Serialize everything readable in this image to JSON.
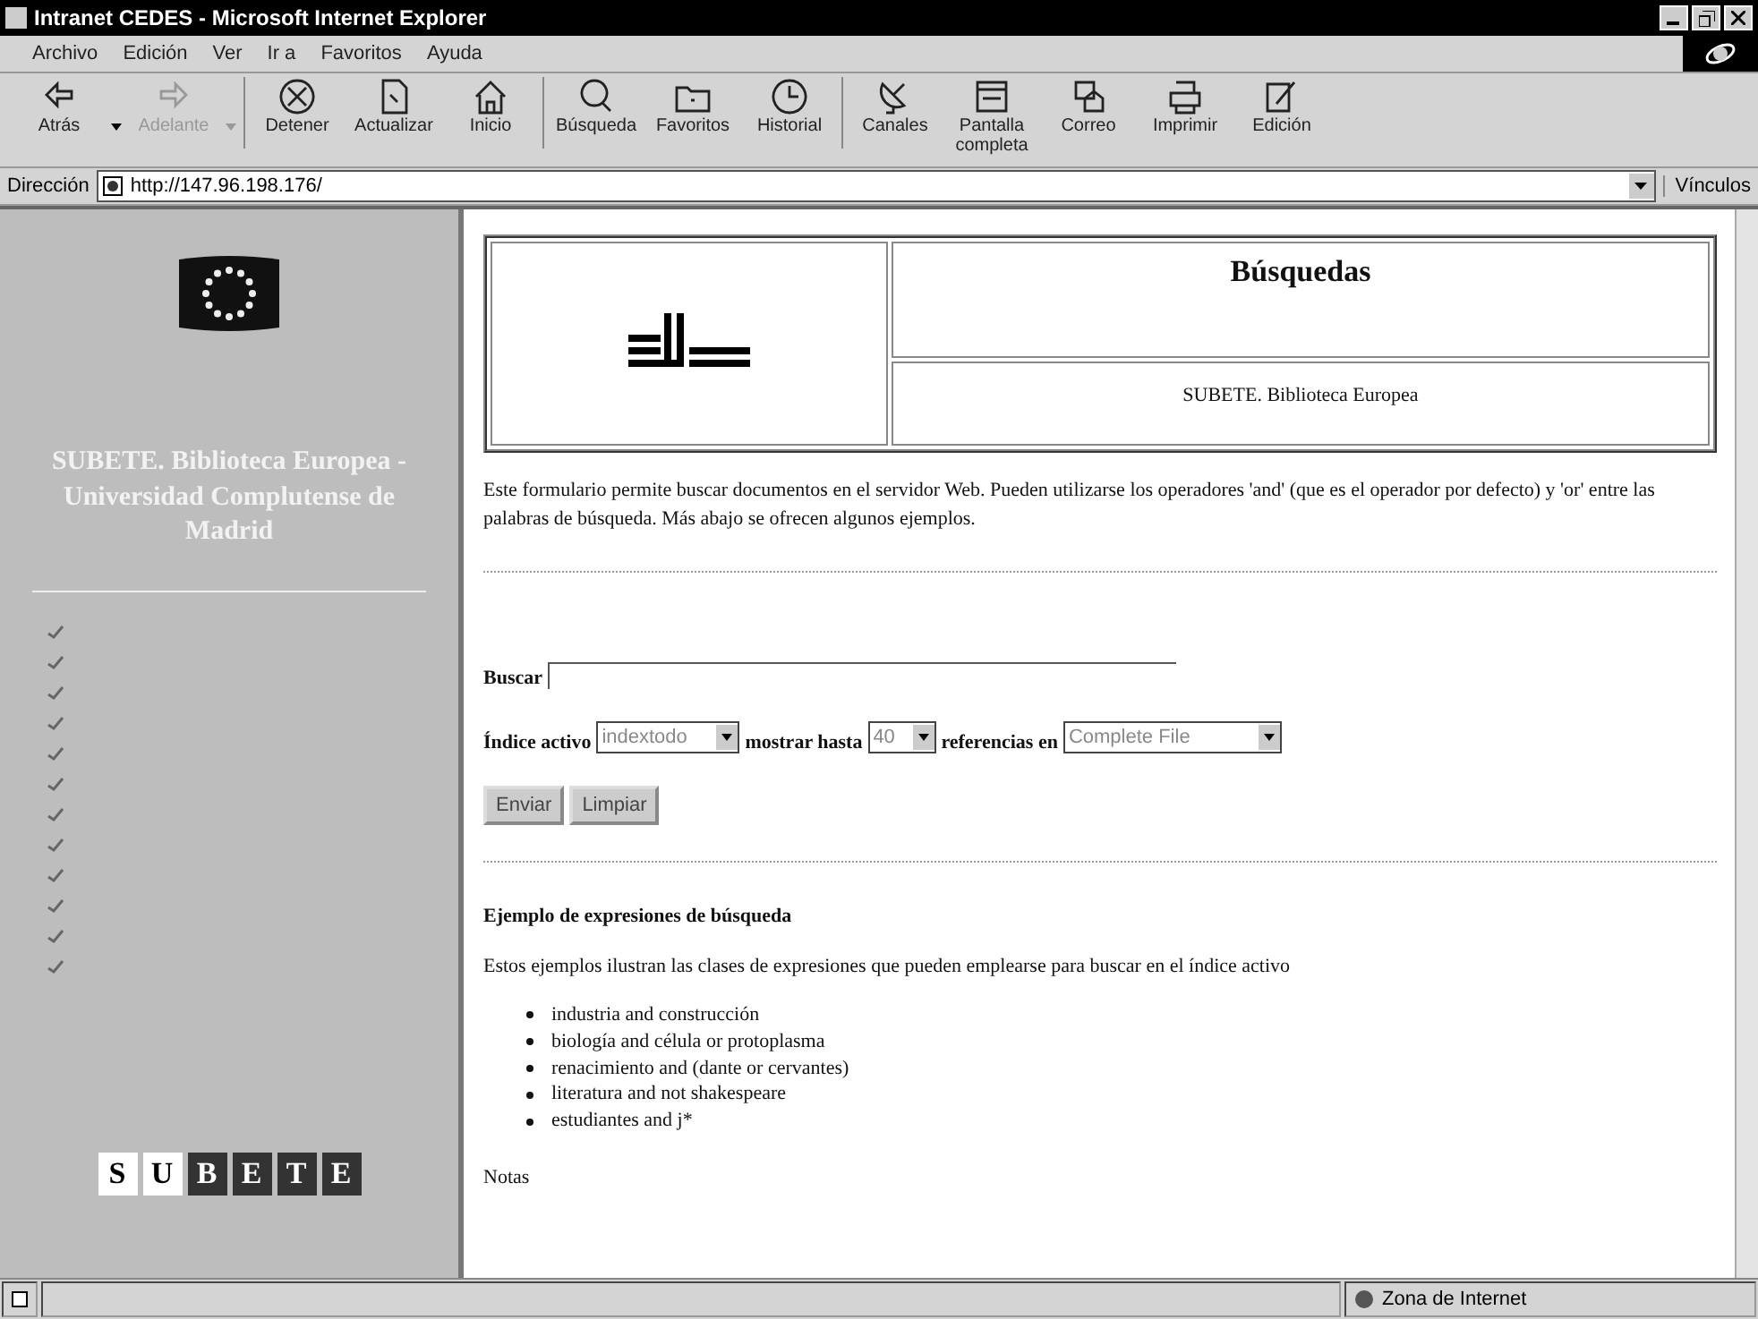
{
  "window": {
    "title": "Intranet CEDES - Microsoft Internet Explorer"
  },
  "menu": [
    "Archivo",
    "Edición",
    "Ver",
    "Ir a",
    "Favoritos",
    "Ayuda"
  ],
  "toolbar": [
    {
      "label": "Atrás",
      "disabled": false,
      "has_menu": true
    },
    {
      "label": "Adelante",
      "disabled": true,
      "has_menu": true
    },
    {
      "label": "Detener",
      "disabled": false,
      "has_menu": false
    },
    {
      "label": "Actualizar",
      "disabled": false,
      "has_menu": false
    },
    {
      "label": "Inicio",
      "disabled": false,
      "has_menu": false
    },
    {
      "label": "Búsqueda",
      "disabled": false,
      "has_menu": false
    },
    {
      "label": "Favoritos",
      "disabled": false,
      "has_menu": false
    },
    {
      "label": "Historial",
      "disabled": false,
      "has_menu": false
    },
    {
      "label": "Canales",
      "disabled": false,
      "has_menu": false
    },
    {
      "label": "Pantalla completa",
      "disabled": false,
      "has_menu": false
    },
    {
      "label": "Correo",
      "disabled": false,
      "has_menu": false
    },
    {
      "label": "Imprimir",
      "disabled": false,
      "has_menu": false
    },
    {
      "label": "Edición",
      "disabled": false,
      "has_menu": false
    }
  ],
  "address": {
    "label": "Dirección",
    "value": "http://147.96.198.176/",
    "links": "Vínculos"
  },
  "sidebar": {
    "heading": "SUBETE. Biblioteca Europea - Universidad Complutense de Madrid",
    "logo_letters": [
      {
        "letter": "S",
        "dark": false
      },
      {
        "letter": "U",
        "dark": false
      },
      {
        "letter": "B",
        "dark": true
      },
      {
        "letter": "E",
        "dark": true
      },
      {
        "letter": "T",
        "dark": true
      },
      {
        "letter": "E",
        "dark": true
      }
    ]
  },
  "header": {
    "title": "Búsquedas",
    "subtitle": "SUBETE. Biblioteca Europea"
  },
  "intro": "Este formulario permite buscar documentos en el servidor Web. Pueden utilizarse los operadores 'and' (que es el operador por defecto) y 'or' entre las palabras de búsqueda. Más abajo se ofrecen algunos ejemplos.",
  "form": {
    "search_label": "Buscar",
    "index_label": "Índice activo",
    "index_value": "indextodo",
    "max_label": "mostrar hasta",
    "max_value": "40",
    "refs_label": "referencias en",
    "refs_value": "Complete File",
    "buttons": [
      "Enviar",
      "Limpiar"
    ]
  },
  "examples": {
    "heading": "Ejemplo de expresiones de búsqueda",
    "text": "Estos ejemplos ilustran las clases de expresiones que pueden emplearse para buscar en el índice activo",
    "items": [
      "industria and construcción",
      "biología and célula or protoplasma",
      "renacimiento and (dante or cervantes)",
      "literatura and not shakespeare",
      "estudiantes and j*"
    ]
  },
  "notes_heading": "Notas",
  "status_bar": {
    "zone": "Zona de Internet"
  }
}
